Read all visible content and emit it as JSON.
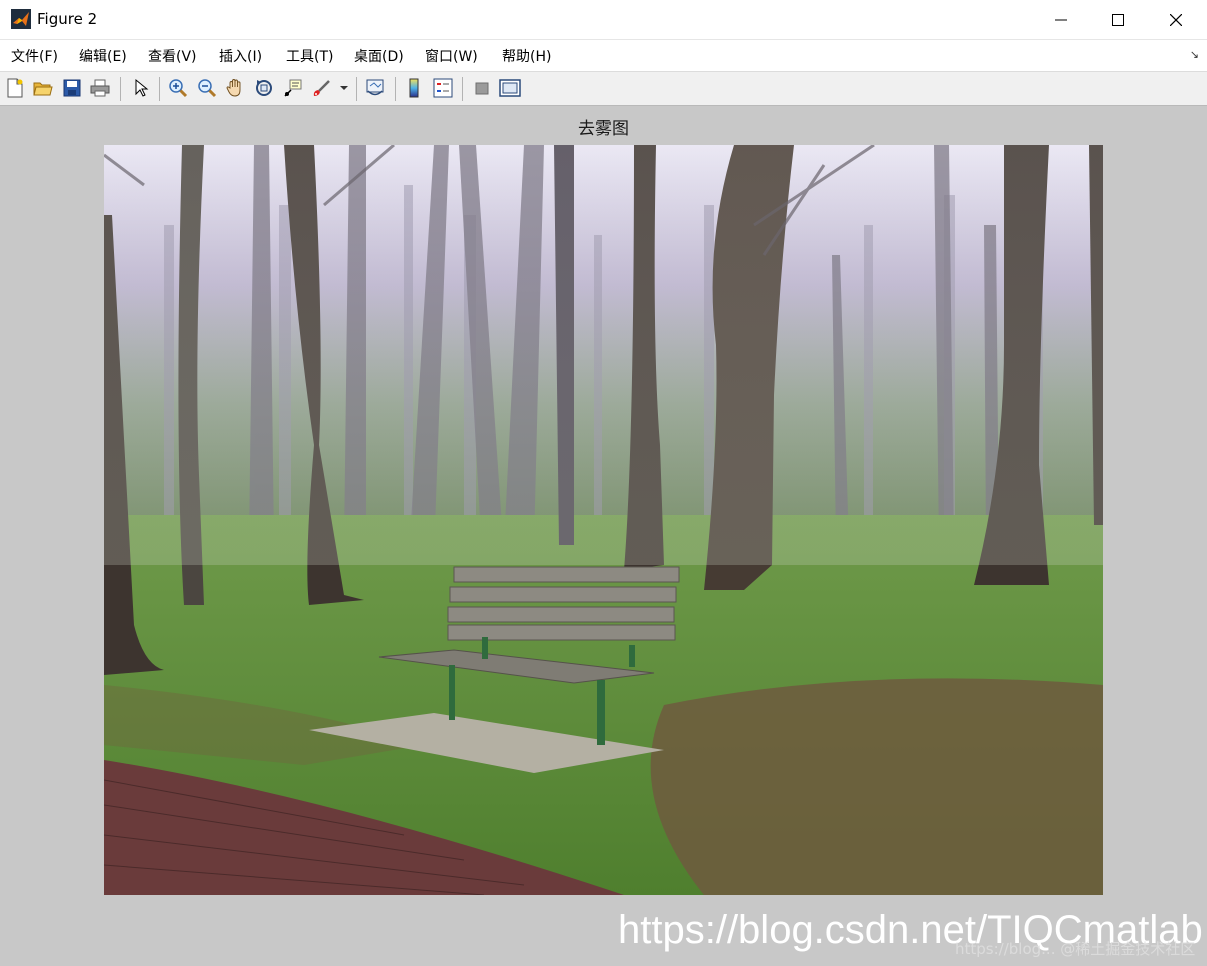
{
  "window": {
    "title": "Figure 2",
    "minimize_label": "",
    "maximize_label": "",
    "close_label": ""
  },
  "menu": {
    "items": [
      "文件(F)",
      "编辑(E)",
      "查看(V)",
      "插入(I)",
      "工具(T)",
      "桌面(D)",
      "窗口(W)",
      "帮助(H)"
    ]
  },
  "toolbar": {
    "buttons": [
      "new-figure-icon",
      "open-file-icon",
      "save-icon",
      "print-icon",
      "edit-plot-arrow-icon",
      "zoom-in-icon",
      "zoom-out-icon",
      "pan-hand-icon",
      "rotate-3d-icon",
      "data-cursor-icon",
      "brush-icon",
      "brush-dropdown-icon",
      "link-plot-icon",
      "colorbar-icon",
      "legend-icon",
      "hide-plot-tools-icon",
      "show-plot-tools-icon"
    ]
  },
  "axes": {
    "title": "去雾图"
  },
  "image": {
    "description_icon": "dehazed-park-bench-image"
  },
  "watermark": {
    "text": "https://blog.csdn.net/TIQCmatlab",
    "text2": "https://blog... @稀土掘金技术社区"
  },
  "colors": {
    "figure_background": "#c8c8c8",
    "titlebar": "#ffffff",
    "toolbar": "#f0f0f0"
  }
}
